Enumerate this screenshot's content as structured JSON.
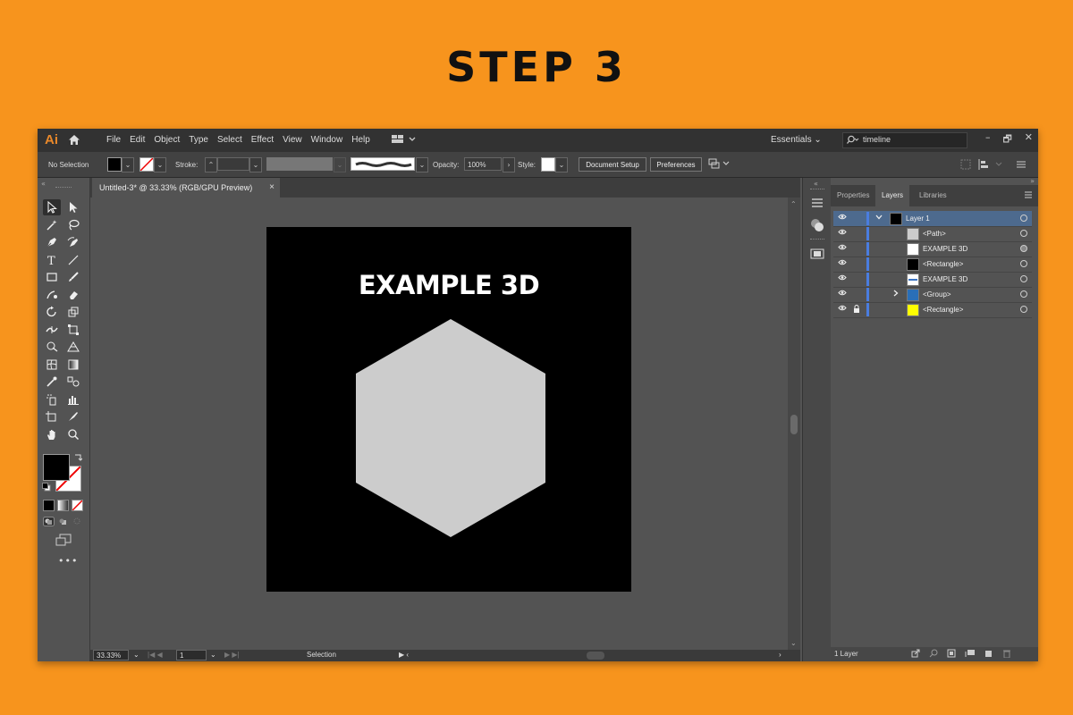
{
  "page_title": "STEP 3",
  "app": {
    "logo": "Ai",
    "menu": [
      "File",
      "Edit",
      "Object",
      "Type",
      "Select",
      "Effect",
      "View",
      "Window",
      "Help"
    ],
    "workspace": "Essentials",
    "search_value": "timeline",
    "window_buttons": [
      "–",
      "🗗",
      "✕"
    ]
  },
  "control_bar": {
    "selection_status": "No Selection",
    "stroke_label": "Stroke:",
    "opacity_label": "Opacity:",
    "opacity_value": "100%",
    "style_label": "Style:",
    "document_setup": "Document Setup",
    "preferences": "Preferences"
  },
  "document": {
    "tab_title": "Untitled-3* @ 33.33% (RGB/GPU Preview)",
    "close": "×",
    "artboard_text": "EXAMPLE 3D",
    "artboard_bg": "#000000",
    "hexagon_color": "#CCCCCC"
  },
  "status_bar": {
    "zoom": "33.33%",
    "artboard_number": "1",
    "tool": "Selection"
  },
  "right_panel": {
    "tabs": [
      "Properties",
      "Layers",
      "Libraries"
    ],
    "active_tab": "Layers",
    "layers": [
      {
        "name": "Layer 1",
        "thumb": "#000000",
        "expanded": true,
        "top": true
      },
      {
        "name": "<Path>",
        "thumb": "#CCCCCC"
      },
      {
        "name": "EXAMPLE 3D",
        "thumb": "#FFFFFF"
      },
      {
        "name": "<Rectangle>",
        "thumb": "#000000"
      },
      {
        "name": "EXAMPLE 3D",
        "thumb": "#FFFFFF"
      },
      {
        "name": "<Group>",
        "thumb": "#2A6FB8",
        "collapsed": true
      },
      {
        "name": "<Rectangle>",
        "thumb": "#FFFF00",
        "locked": true
      }
    ],
    "footer": "1 Layer"
  },
  "colors": {
    "background": "#F7941D",
    "ui_dark": "#323232",
    "selected_layer": "#4D6A8E",
    "layer_bar": "#4A7DE0"
  }
}
